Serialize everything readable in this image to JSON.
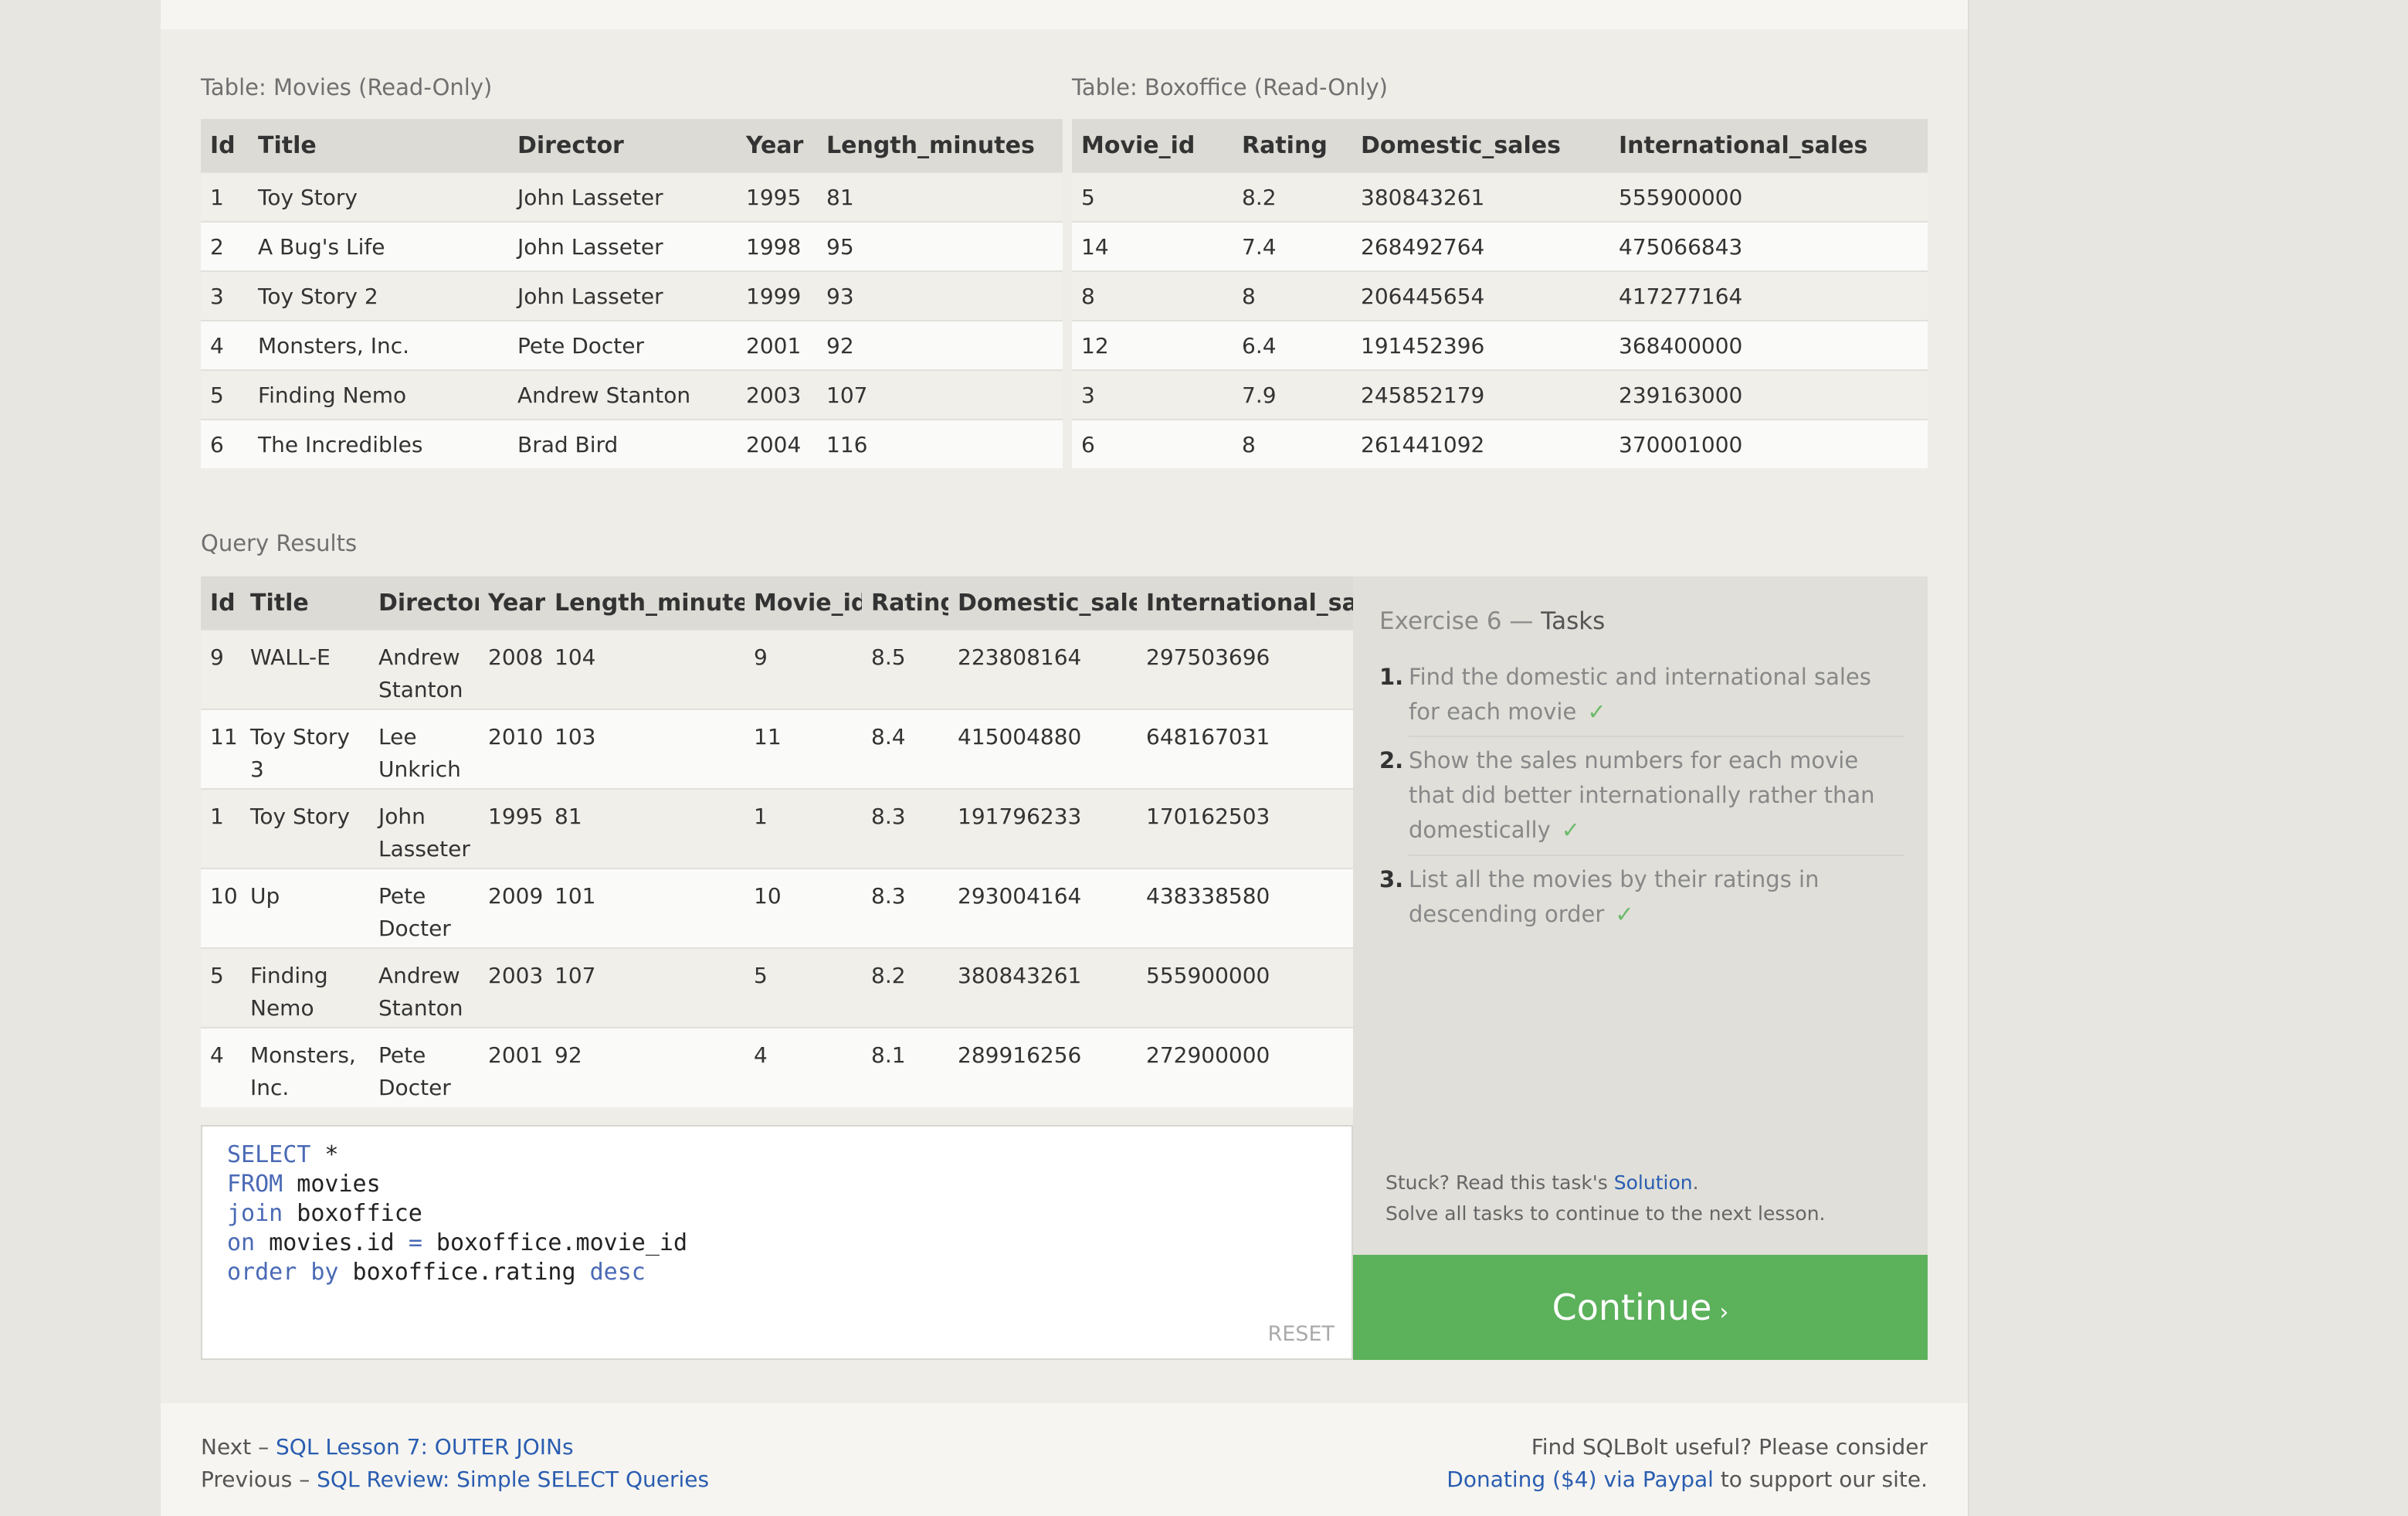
{
  "movies_table": {
    "caption": "Table: Movies (Read-Only)",
    "columns": [
      "Id",
      "Title",
      "Director",
      "Year",
      "Length_minutes"
    ],
    "rows": [
      [
        "1",
        "Toy Story",
        "John Lasseter",
        "1995",
        "81"
      ],
      [
        "2",
        "A Bug's Life",
        "John Lasseter",
        "1998",
        "95"
      ],
      [
        "3",
        "Toy Story 2",
        "John Lasseter",
        "1999",
        "93"
      ],
      [
        "4",
        "Monsters, Inc.",
        "Pete Docter",
        "2001",
        "92"
      ],
      [
        "5",
        "Finding Nemo",
        "Andrew Stanton",
        "2003",
        "107"
      ],
      [
        "6",
        "The Incredibles",
        "Brad Bird",
        "2004",
        "116"
      ]
    ]
  },
  "boxoffice_table": {
    "caption": "Table: Boxoffice (Read-Only)",
    "columns": [
      "Movie_id",
      "Rating",
      "Domestic_sales",
      "International_sales"
    ],
    "rows": [
      [
        "5",
        "8.2",
        "380843261",
        "555900000"
      ],
      [
        "14",
        "7.4",
        "268492764",
        "475066843"
      ],
      [
        "8",
        "8",
        "206445654",
        "417277164"
      ],
      [
        "12",
        "6.4",
        "191452396",
        "368400000"
      ],
      [
        "3",
        "7.9",
        "245852179",
        "239163000"
      ],
      [
        "6",
        "8",
        "261441092",
        "370001000"
      ]
    ]
  },
  "query_results": {
    "caption": "Query Results",
    "columns": [
      "Id",
      "Title",
      "Director",
      "Year",
      "Length_minutes",
      "Movie_id",
      "Rating",
      "Domestic_sales",
      "International_sales"
    ],
    "rows": [
      [
        "9",
        "WALL-E",
        "Andrew Stanton",
        "2008",
        "104",
        "9",
        "8.5",
        "223808164",
        "297503696"
      ],
      [
        "11",
        "Toy Story 3",
        "Lee Unkrich",
        "2010",
        "103",
        "11",
        "8.4",
        "415004880",
        "648167031"
      ],
      [
        "1",
        "Toy Story",
        "John Lasseter",
        "1995",
        "81",
        "1",
        "8.3",
        "191796233",
        "170162503"
      ],
      [
        "10",
        "Up",
        "Pete Docter",
        "2009",
        "101",
        "10",
        "8.3",
        "293004164",
        "438338580"
      ],
      [
        "5",
        "Finding Nemo",
        "Andrew Stanton",
        "2003",
        "107",
        "5",
        "8.2",
        "380843261",
        "555900000"
      ],
      [
        "4",
        "Monsters, Inc.",
        "Pete Docter",
        "2001",
        "92",
        "4",
        "8.1",
        "289916256",
        "272900000"
      ]
    ]
  },
  "editor": {
    "lines": [
      [
        {
          "t": "SELECT",
          "k": true
        },
        {
          "t": " *",
          "k": false
        }
      ],
      [
        {
          "t": "FROM",
          "k": true
        },
        {
          "t": " movies",
          "k": false
        }
      ],
      [
        {
          "t": "join",
          "k": true
        },
        {
          "t": " boxoffice",
          "k": false
        }
      ],
      [
        {
          "t": "on",
          "k": true
        },
        {
          "t": " movies.id ",
          "k": false
        },
        {
          "t": "=",
          "k": true
        },
        {
          "t": " boxoffice.movie_id",
          "k": false
        }
      ],
      [
        {
          "t": "order by",
          "k": true
        },
        {
          "t": " boxoffice.rating ",
          "k": false
        },
        {
          "t": "desc",
          "k": true
        }
      ]
    ],
    "reset_label": "RESET"
  },
  "tasks": {
    "title_prefix": "Exercise 6 — ",
    "title_main": "Tasks",
    "items": [
      {
        "num": "1.",
        "text": "Find the domestic and international sales for each movie"
      },
      {
        "num": "2.",
        "text": "Show the sales numbers for each movie that did better internationally rather than domestically"
      },
      {
        "num": "3.",
        "text": "List all the movies by their ratings in descending order"
      }
    ],
    "check": "✓",
    "stuck_prefix": "Stuck? Read this task's ",
    "solution_link": "Solution",
    "stuck_suffix": ".",
    "solve_all": "Solve all tasks to continue to the next lesson."
  },
  "continue_button": {
    "label": "Continue",
    "arrow": "›"
  },
  "footer": {
    "next_prefix": "Next – ",
    "next_link": "SQL Lesson 7: OUTER JOINs",
    "prev_prefix": "Previous – ",
    "prev_link": "SQL Review: Simple SELECT Queries",
    "support_line1": "Find SQLBolt useful? Please consider",
    "donate_link": "Donating ($4) via Paypal",
    "support_suffix": " to support our site."
  },
  "colors": {
    "accent_green": "#5cb15b",
    "link_blue": "#2a5db0",
    "keyword_blue": "#4a6ab5",
    "check_green": "#6cbb6a"
  }
}
